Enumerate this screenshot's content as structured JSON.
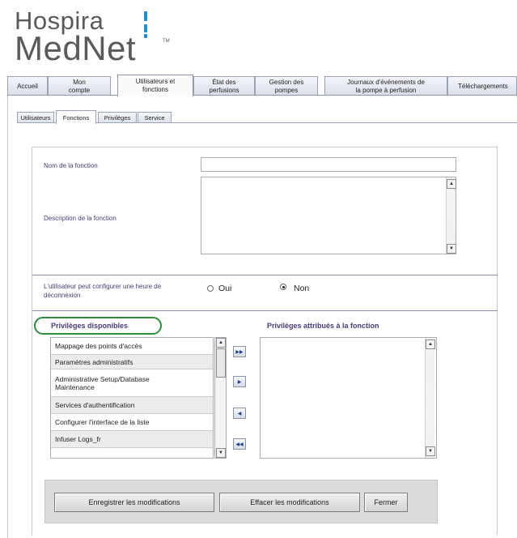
{
  "logo": {
    "line1": "Hospira",
    "line2": "MedNet",
    "tm": "TM"
  },
  "main_tabs": [
    {
      "label": "Accueil"
    },
    {
      "label": "Mon\ncompte"
    },
    {
      "label": "Utilisateurs et\nfonctions"
    },
    {
      "label": "État des\nperfusions"
    },
    {
      "label": "Gestion des\npompes"
    },
    {
      "label": "Journaux d'événements de\nla pompe à perfusion"
    },
    {
      "label": "Téléchargements"
    }
  ],
  "sub_tabs": [
    {
      "label": "Utilisateurs"
    },
    {
      "label": "Fonctions"
    },
    {
      "label": "Privilèges"
    },
    {
      "label": "Service"
    }
  ],
  "form": {
    "name_label": "Nom de la fonction",
    "name_value": "",
    "description_label": "Description de la fonction",
    "description_value": "",
    "logout_label": "L'utilisateur peut configurer une heure de déconnexion",
    "radio_oui": "Oui",
    "radio_non": "Non",
    "selected_radio": "Non"
  },
  "available_privileges": {
    "title": "Privilèges disponibles",
    "items": [
      "Mappage des points d'accès",
      "Paramètres administratifs",
      "Administrative Setup/Database Maintenance",
      "Services d'authentification",
      "Configurer l'interface de la liste",
      "Infuser Logs_fr"
    ]
  },
  "assigned_privileges": {
    "title": "Privilèges attribués à la fonction",
    "items": []
  },
  "icons": {
    "move_all_right": "▶▶",
    "move_right": "▶",
    "move_left": "◀",
    "move_all_left": "◀◀",
    "scroll_up": "▲",
    "scroll_down": "▼"
  },
  "buttons": {
    "save": "Enregistrer les modifications",
    "clear": "Effacer les modifications",
    "close": "Fermer"
  }
}
